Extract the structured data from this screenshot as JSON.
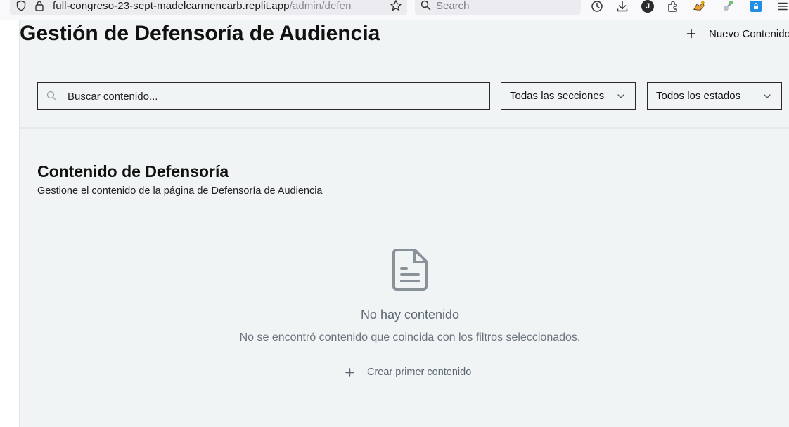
{
  "browser": {
    "url_host": "full-congreso-23-sept-madelcarmencarb.replit.app",
    "url_path": "/admin/defen",
    "search_placeholder": "Search",
    "avatar_letter": "J"
  },
  "header": {
    "title": "Gestión de Defensoría de Audiencia",
    "new_button_label": "Nuevo Contenido"
  },
  "filters": {
    "search_placeholder": "Buscar contenido...",
    "sections_select": {
      "selected": "Todas las secciones"
    },
    "states_select": {
      "selected": "Todos los estados"
    }
  },
  "content": {
    "title": "Contenido de Defensoría",
    "description": "Gestione el contenido de la página de Defensoría de Audiencia",
    "empty": {
      "icon": "file-text-icon",
      "title": "No hay contenido",
      "message": "No se encontró contenido que coincida con los filtros seleccionados.",
      "create_label": "Crear primer contenido"
    }
  },
  "colors": {
    "page_background": "#f1f4f5",
    "muted_text": "#6a737c",
    "border": "#2a2a2a"
  }
}
